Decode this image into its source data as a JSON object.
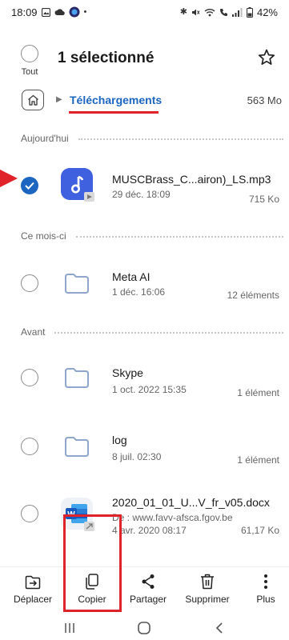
{
  "status_bar": {
    "time": "18:09",
    "battery": "42%"
  },
  "header": {
    "select_all_label": "Tout",
    "title": "1 sélectionné"
  },
  "path": {
    "folder": "Téléchargements",
    "storage": "563 Mo"
  },
  "sections": {
    "today": "Aujourd'hui",
    "this_month": "Ce mois-ci",
    "before": "Avant"
  },
  "files": [
    {
      "name": "MUSCBrass_C...airon)_LS.mp3",
      "meta": "29 déc. 18:09",
      "size": "715 Ko",
      "icon": "music-file-icon",
      "checked": true
    },
    {
      "name": "Meta AI",
      "meta": "1 déc. 16:06",
      "size": "12 éléments",
      "icon": "folder-icon",
      "checked": false
    },
    {
      "name": "Skype",
      "meta": "1 oct. 2022 15:35",
      "size": "1 élément",
      "icon": "folder-icon",
      "checked": false
    },
    {
      "name": "log",
      "meta": "8 juil. 02:30",
      "size": "1 élément",
      "icon": "folder-icon",
      "checked": false
    },
    {
      "name": "2020_01_01_U...V_fr_v05.docx",
      "source": "De : www.favv-afsca.fgov.be",
      "meta": "4 avr. 2020 08:17",
      "size": "61,17 Ko",
      "icon": "word-file-icon",
      "checked": false
    }
  ],
  "actions": {
    "move": "Déplacer",
    "copy": "Copier",
    "share": "Partager",
    "delete": "Supprimer",
    "more": "Plus"
  },
  "colors": {
    "accent": "#1c66c2",
    "annotation": "#e0222b"
  }
}
